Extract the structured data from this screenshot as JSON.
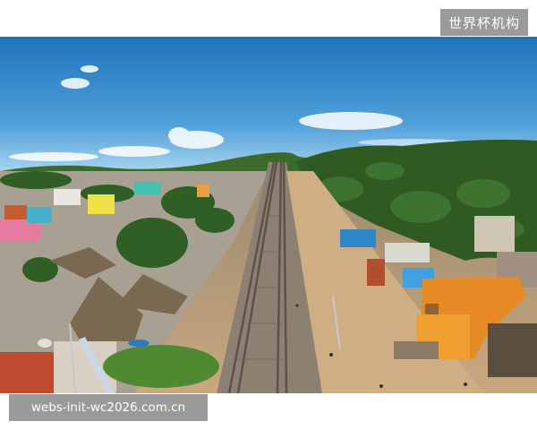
{
  "watermarks": {
    "brand": "世界杯机构",
    "url": "webs-init-wc2026.com.cn"
  },
  "photo": {
    "subject": "aerial-view-railway-through-coastal-town",
    "colors": {
      "sky_top": "#1f73be",
      "sky_bottom": "#8fc8ea",
      "palms": "#2f5a22",
      "ground": "#c8a77c",
      "rail": "#7a6a5c",
      "orange_house": "#e58a25",
      "blue_house": "#2f86c9"
    }
  }
}
